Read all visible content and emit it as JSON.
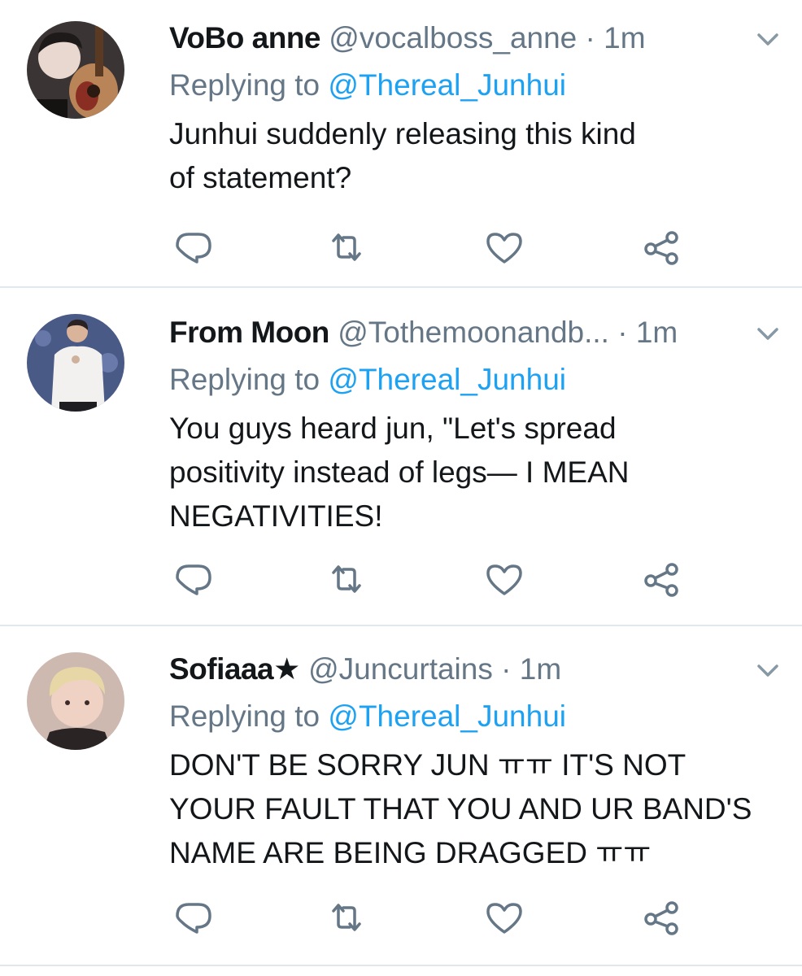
{
  "tweets": [
    {
      "display_name": "VoBo anne",
      "handle": "@vocalboss_anne",
      "separator": "·",
      "time": "1m",
      "replying_prefix": "Replying to",
      "replying_mention": "@Thereal_Junhui",
      "text": "Junhui suddenly releasing this kind\nof statement?",
      "avatar_icon": "avatar-guitar-person"
    },
    {
      "display_name": "From Moon",
      "handle": "@Tothemoonandb...",
      "separator": "·",
      "time": "1m",
      "replying_prefix": "Replying to",
      "replying_mention": "@Thereal_Junhui",
      "text": "You guys heard jun, \"Let's spread\npositivity instead of legs— I MEAN\nNEGATIVITIES!",
      "avatar_icon": "avatar-person-white-shirt"
    },
    {
      "display_name": "Sofiaaa★",
      "handle": "@Juncurtains",
      "separator": "·",
      "time": "1m",
      "replying_prefix": "Replying to",
      "replying_mention": "@Thereal_Junhui",
      "text": "DON'T BE SORRY JUN ㅠㅠ IT'S NOT\nYOUR FAULT THAT YOU AND UR BAND'S\nNAME ARE BEING DRAGGED ㅠㅠ",
      "avatar_icon": "avatar-blonde-person"
    }
  ],
  "action_icons": [
    "reply-icon",
    "retweet-icon",
    "like-icon",
    "share-icon"
  ],
  "colors": {
    "text": "#14171a",
    "secondary": "#657786",
    "mention": "#1da1f2",
    "divider": "#e1e8ed"
  }
}
